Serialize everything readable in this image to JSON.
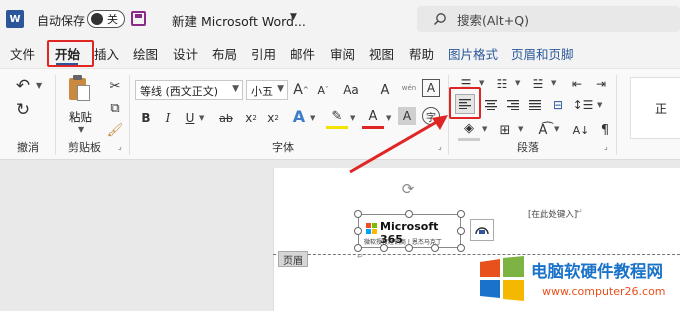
{
  "titlebar": {
    "autosave_label": "自动保存",
    "autosave_state": "关",
    "doc_title": "新建 Microsoft Word...",
    "search_placeholder": "搜索(Alt+Q)"
  },
  "tabs": [
    "文件",
    "开始",
    "插入",
    "绘图",
    "设计",
    "布局",
    "引用",
    "邮件",
    "审阅",
    "视图",
    "帮助",
    "图片格式",
    "页眉和页脚"
  ],
  "ribbon": {
    "undo_group_label": "撤消",
    "clipboard_group_label": "剪贴板",
    "paste_label": "粘贴",
    "font_group_label": "字体",
    "paragraph_group_label": "段落",
    "font_name": "等线 (西文正文)",
    "font_size": "小五",
    "grow_font": "A",
    "shrink_font": "A",
    "case_label": "Aa",
    "clear_format": "A",
    "wen_label": "wén",
    "char_border": "A",
    "bold": "B",
    "italic": "I",
    "underline": "U",
    "strike": "ab",
    "subscript": "x",
    "superscript": "x",
    "text_effect": "A",
    "font_color": "A",
    "shading": "A",
    "circle_char": "字",
    "styles_preview": "正"
  },
  "document": {
    "header_placeholder": "[在此处键入]",
    "header_tag": "页眉",
    "logo_title": "Microsoft 365",
    "logo_subtitle": "微软授权经销商 | 恩杰马克丁"
  },
  "watermark": {
    "title": "电脑软硬件教程网",
    "url": "www.computer26.com"
  },
  "colors": {
    "accent": "#2b579a",
    "highlight_red": "#e02525",
    "watermark_blue": "#1a73c8",
    "watermark_orange": "#e8501c"
  }
}
